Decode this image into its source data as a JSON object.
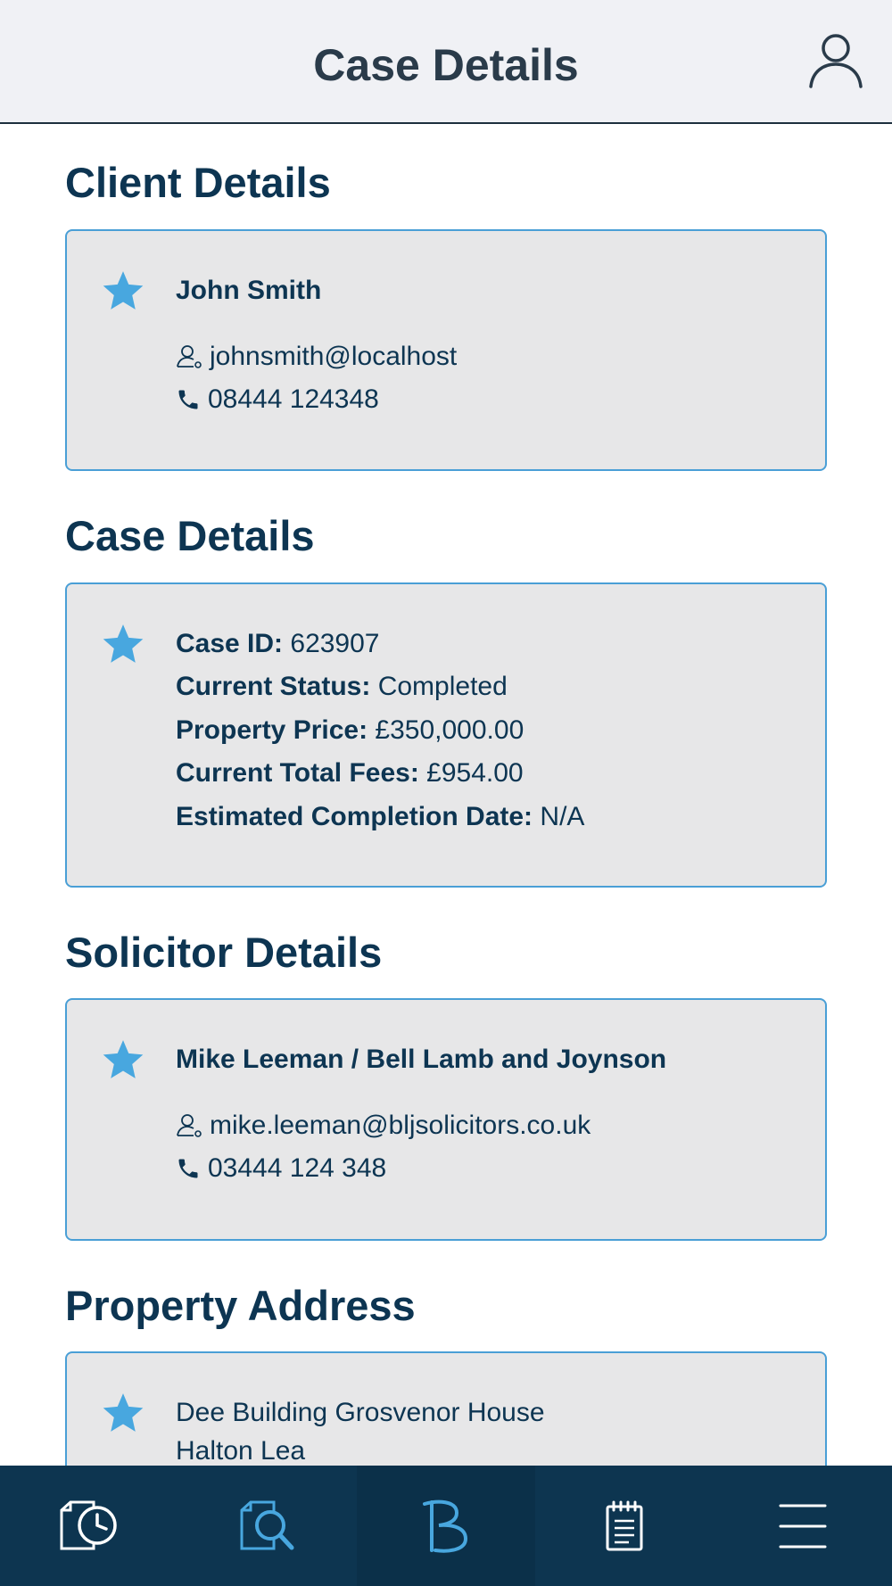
{
  "header": {
    "title": "Case Details"
  },
  "client": {
    "section_title": "Client Details",
    "name": "John Smith",
    "email": "johnsmith@localhost",
    "phone": "08444 124348"
  },
  "case": {
    "section_title": "Case Details",
    "fields": [
      {
        "label": "Case ID:",
        "value": " 623907"
      },
      {
        "label": "Current Status:",
        "value": " Completed"
      },
      {
        "label": "Property Price:",
        "value": " £350,000.00"
      },
      {
        "label": "Current Total Fees:",
        "value": " £954.00"
      },
      {
        "label": "Estimated Completion Date:",
        "value": " N/A"
      }
    ]
  },
  "solicitor": {
    "section_title": "Solicitor Details",
    "name": "Mike Leeman / Bell Lamb and Joynson",
    "email": "mike.leeman@bljsolicitors.co.uk",
    "phone": "03444 124 348"
  },
  "property": {
    "section_title": "Property Address",
    "lines": [
      "Dee Building Grosvenor House",
      "Halton Lea"
    ]
  },
  "nav": {
    "items": [
      {
        "icon": "case-history-icon"
      },
      {
        "icon": "document-search-icon"
      },
      {
        "icon": "brand-logo-icon"
      },
      {
        "icon": "notepad-icon"
      },
      {
        "icon": "menu-icon"
      }
    ]
  },
  "colors": {
    "navy": "#0d3552",
    "accent_blue": "#48a7df",
    "card_bg": "#e7e7e8",
    "card_border": "#4a9fd6",
    "header_bg": "#f0f1f5"
  }
}
